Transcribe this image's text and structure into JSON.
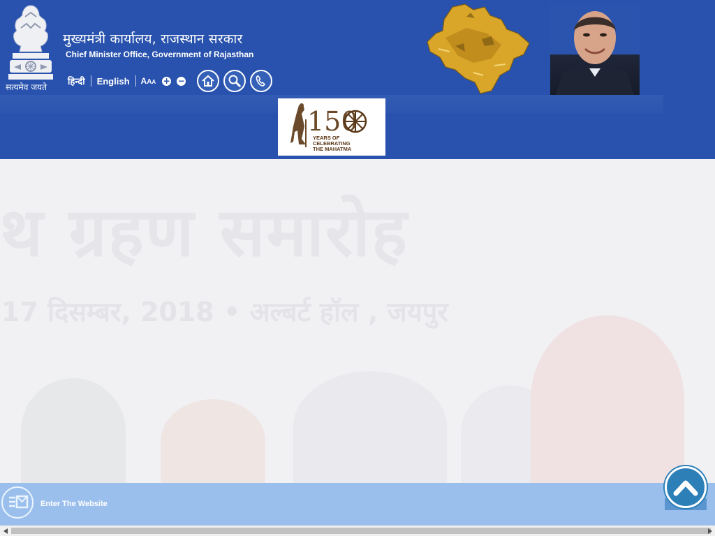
{
  "header": {
    "title_hindi": "मुख्यमंत्री कार्यालय, राजस्थान सरकार",
    "title_english": "Chief Minister Office, Government of Rajasthan",
    "motto": "सत्यमेव जयते"
  },
  "toolbar": {
    "hindi_label": "हिन्दी",
    "english_label": "English",
    "font_size_label": [
      "A",
      "A",
      "A"
    ],
    "increase_label": "+",
    "decrease_label": "−"
  },
  "badge": {
    "number": "150",
    "text": "YEARS OF\nCELEBRATING\nTHE MAHATMA"
  },
  "hero": {
    "heading": "थ ग्रहण समारोह",
    "subheading": "17 दिसम्बर, 2018  •  अल्बर्ट हॉल , जयपुर"
  },
  "enter": {
    "label": "Enter The Website"
  },
  "colors": {
    "header_bg": "#2852ad",
    "enter_bar": "#82b0ea",
    "scroll_top": "#2d7fb8",
    "badge_brown": "#5a3716",
    "map_gold": "#d9a62a"
  },
  "icons": [
    "national-emblem-icon",
    "home-icon",
    "search-icon",
    "phone-icon",
    "chevron-up-icon",
    "enter-icon"
  ]
}
